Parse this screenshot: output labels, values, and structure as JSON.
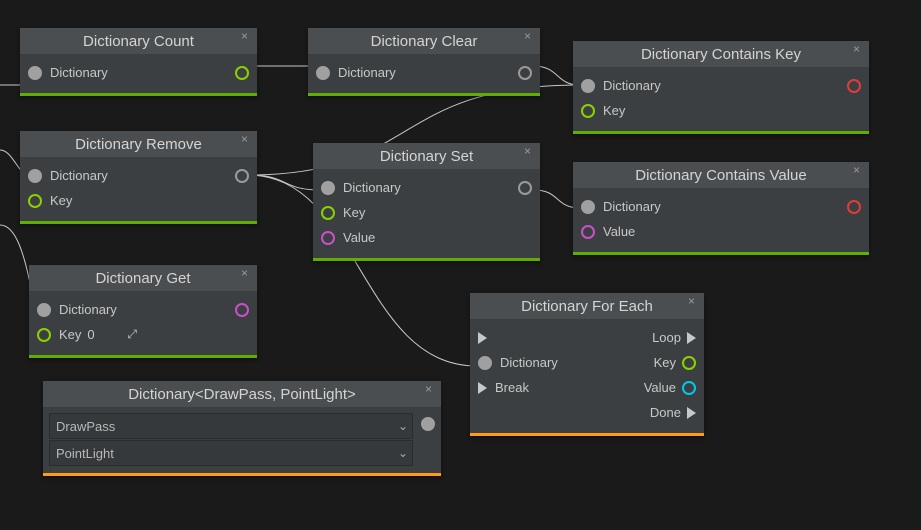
{
  "nodes": {
    "count": {
      "title": "Dictionary Count",
      "inputs": [
        "Dictionary"
      ]
    },
    "clear": {
      "title": "Dictionary Clear",
      "inputs": [
        "Dictionary"
      ]
    },
    "containsKey": {
      "title": "Dictionary Contains Key",
      "inputs": [
        "Dictionary",
        "Key"
      ]
    },
    "remove": {
      "title": "Dictionary Remove",
      "inputs": [
        "Dictionary",
        "Key"
      ]
    },
    "set": {
      "title": "Dictionary Set",
      "inputs": [
        "Dictionary",
        "Key",
        "Value"
      ]
    },
    "containsValue": {
      "title": "Dictionary Contains Value",
      "inputs": [
        "Dictionary",
        "Value"
      ]
    },
    "get": {
      "title": "Dictionary Get",
      "inputs": [
        "Dictionary",
        "Key"
      ],
      "keyValue": "0"
    },
    "foreach": {
      "title": "Dictionary For Each",
      "inputs": [
        "Dictionary",
        "Break"
      ],
      "outputs": [
        "Loop",
        "Key",
        "Value",
        "Done"
      ]
    },
    "typed": {
      "title": "Dictionary<DrawPass, PointLight>",
      "rows": [
        "DrawPass",
        "PointLight"
      ]
    }
  }
}
